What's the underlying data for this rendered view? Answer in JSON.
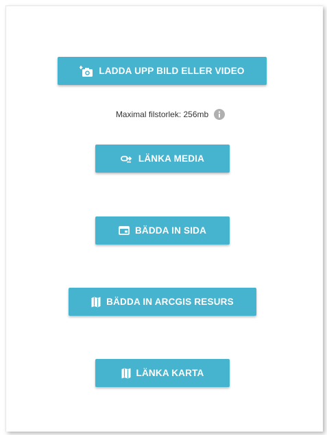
{
  "buttons": {
    "upload": {
      "label": "LADDA UPP BILD ELLER VIDEO",
      "icon": "camera-add-icon"
    },
    "link_media": {
      "label": "LÄNKA MEDIA",
      "icon": "link-icon"
    },
    "embed_page": {
      "label": "BÄDDA IN SIDA",
      "icon": "browser-window-icon"
    },
    "embed_arcgis": {
      "label": "BÄDDA IN ARCGIS RESURS",
      "icon": "map-icon"
    },
    "link_map": {
      "label": "LÄNKA KARTA",
      "icon": "map-icon"
    }
  },
  "upload_info": {
    "text": "Maximal filstorlek: 256mb",
    "icon": "info-icon"
  },
  "colors": {
    "button_bg": "#46b3cf",
    "button_text": "#ffffff",
    "info_icon": "#b0b0b0"
  }
}
